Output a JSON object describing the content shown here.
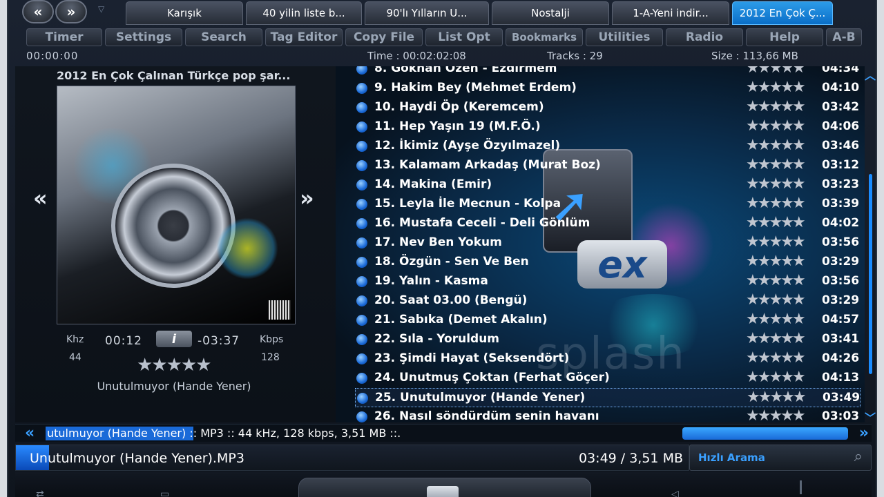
{
  "nav": {
    "back": "«",
    "forward": "»"
  },
  "tabs": [
    {
      "label": "Karışık",
      "active": false
    },
    {
      "label": "40 yilin liste b...",
      "active": false
    },
    {
      "label": "90'lı Yılların U...",
      "active": false
    },
    {
      "label": "Nostalji",
      "active": false
    },
    {
      "label": "1-A-Yeni indir...",
      "active": false
    },
    {
      "label": "2012 En Çok Ç...",
      "active": true
    }
  ],
  "menu": [
    "Timer",
    "Settings",
    "Search",
    "Tag Editor",
    "Copy File",
    "List Opt",
    "Bookmarks",
    "Utilities",
    "Radio",
    "Help",
    "A-B"
  ],
  "status": {
    "elapsed": "00:00:00",
    "total_time": "Time : 00:02:02:08",
    "tracks": "Tracks : 29",
    "size": "Size : 113,66 MB"
  },
  "album": {
    "title": "2012 En Çok Çalınan Türkçe pop şar...",
    "prev": "«",
    "next": "»"
  },
  "player": {
    "khz_label": "Khz",
    "khz": "44",
    "position": "00:12",
    "info": "i",
    "remaining": "-03:37",
    "kbps_label": "Kbps",
    "kbps": "128",
    "rating": "★★★★★",
    "now_title": "Unutulmuyor (Hande Yener)"
  },
  "playlist": {
    "rows": [
      {
        "name": "8. Gökhan Özen - Ezdirmem",
        "dur": "04:34",
        "stars": "★★★★★",
        "selected": false
      },
      {
        "name": "9. Hakim Bey (Mehmet Erdem)",
        "dur": "04:10",
        "stars": "★★★★★",
        "selected": false
      },
      {
        "name": "10. Haydi Öp (Keremcem)",
        "dur": "03:42",
        "stars": "★★★★★",
        "selected": false
      },
      {
        "name": "11. Hep Yaşın 19 (M.F.Ö.)",
        "dur": "04:06",
        "stars": "★★★★★",
        "selected": false
      },
      {
        "name": "12. İkimiz (Ayşe Özyılmazel)",
        "dur": "03:46",
        "stars": "★★★★★",
        "selected": false
      },
      {
        "name": "13. Kalamam Arkadaş (Murat Boz)",
        "dur": "03:12",
        "stars": "★★★★★",
        "selected": false
      },
      {
        "name": "14. Makina (Emir)",
        "dur": "03:23",
        "stars": "★★★★★",
        "selected": false
      },
      {
        "name": "15. Leyla İle Mecnun - Kolpa",
        "dur": "03:39",
        "stars": "★★★★★",
        "selected": false
      },
      {
        "name": "16. Mustafa Ceceli - Deli Gönlüm",
        "dur": "04:02",
        "stars": "★★★★★",
        "selected": false
      },
      {
        "name": "17. Nev Ben Yokum",
        "dur": "03:56",
        "stars": "★★★★★",
        "selected": false
      },
      {
        "name": "18. Özgün - Sen Ve Ben",
        "dur": "03:29",
        "stars": "★★★★★",
        "selected": false
      },
      {
        "name": "19. Yalın - Kasma",
        "dur": "03:56",
        "stars": "★★★★★",
        "selected": false
      },
      {
        "name": "20. Saat 03.00 (Bengü)",
        "dur": "03:29",
        "stars": "★★★★★",
        "selected": false
      },
      {
        "name": "21. Sabıka (Demet Akalın)",
        "dur": "04:57",
        "stars": "★★★★★",
        "selected": false
      },
      {
        "name": "22. Sıla - Yoruldum",
        "dur": "03:41",
        "stars": "★★★★★",
        "selected": false
      },
      {
        "name": "23. Şimdi Hayat (Seksendört)",
        "dur": "04:26",
        "stars": "★★★★★",
        "selected": false
      },
      {
        "name": "24. Unutmuş Çoktan (Ferhat Göçer)",
        "dur": "04:13",
        "stars": "★★★★★",
        "selected": false
      },
      {
        "name": "25. Unutulmuyor (Hande Yener)",
        "dur": "03:49",
        "stars": "★★★★★",
        "selected": true
      },
      {
        "name": "26. Nasıl söndürdüm senin havanı",
        "dur": "03:03",
        "stars": "★★★★★",
        "selected": false
      }
    ]
  },
  "skin_logo": {
    "ex": "ex",
    "splash": "splash"
  },
  "marquee": {
    "left": "«",
    "right": "»",
    "text": "utulmuyor (Hande Yener) :: MP3 :: 44 kHz, 128 kbps, 3,51 MB ::."
  },
  "filebar": {
    "name": "Unutulmuyor (Hande Yener).MP3",
    "right": "03:49 / 3,51 MB"
  },
  "search": {
    "placeholder": "Hızlı Arama"
  },
  "colors": {
    "accent": "#1a8cff",
    "selected_border": "#7ab8ff"
  }
}
